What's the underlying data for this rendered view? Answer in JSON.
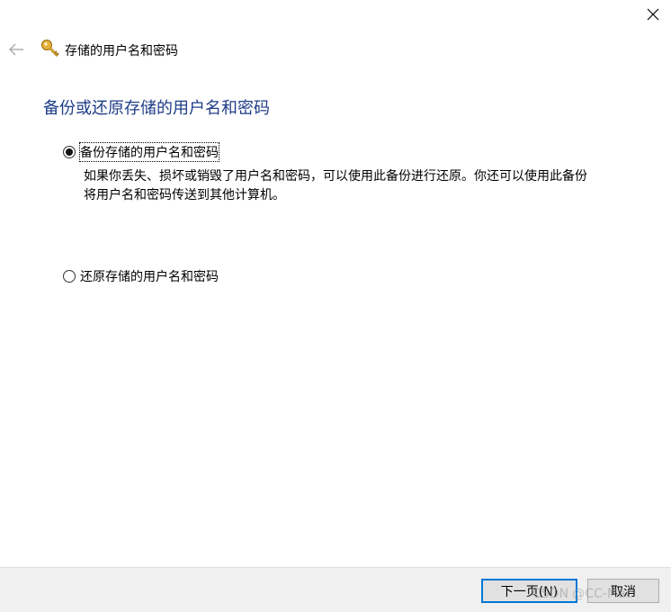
{
  "window": {
    "close_icon": "close-icon"
  },
  "header": {
    "back_icon": "back-arrow-icon",
    "app_icon": "key-icon",
    "title": "存储的用户名和密码"
  },
  "main": {
    "heading": "备份或还原存储的用户名和密码",
    "options": [
      {
        "label": "备份存储的用户名和密码",
        "selected": true,
        "description_line1": "如果你丢失、损坏或销毁了用户名和密码，可以使用此备份进行还原。你还可以使用此备份",
        "description_line2": "将用户名和密码传送到其他计算机。"
      },
      {
        "label": "还原存储的用户名和密码",
        "selected": false
      }
    ]
  },
  "footer": {
    "next_label": "下一页(N)",
    "cancel_label": "取消"
  },
  "watermark": "CSDN @CC-Mac",
  "colors": {
    "heading": "#1f3d87",
    "footer_bg": "#f0f0f0",
    "default_button_border": "#0078d7"
  }
}
